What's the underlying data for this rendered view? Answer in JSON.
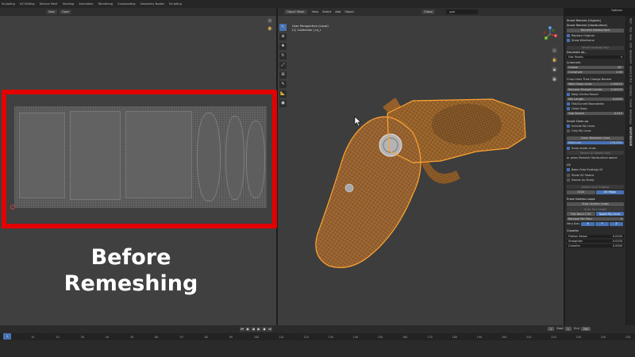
{
  "workspaces": [
    "Sculpting",
    "UV Editing",
    "Texture Paint",
    "Shading",
    "Animation",
    "Rendering",
    "Compositing",
    "Geometry Nodes",
    "Scripting"
  ],
  "uv_editor": {
    "new_label": "New",
    "open_label": "Open"
  },
  "caption": {
    "line1": "Before",
    "line2": "Remeshing"
  },
  "viewport": {
    "mode": "Object Mode",
    "menus": [
      "View",
      "Select",
      "Add",
      "Object"
    ],
    "orientation": "Global",
    "search_value": "gun",
    "view_title": "User Perspective (Local)",
    "collection": "(1) Collection | rp_r",
    "options_label": "Options",
    "gizmo": {
      "x": "X",
      "y": "Y",
      "z": "Z"
    }
  },
  "side_panel": {
    "rows": [
      {
        "kind": "header",
        "text": "Smart Remesh (Organic)"
      },
      {
        "kind": "header",
        "text": "Smart Remesh (Hardsurface)"
      },
      {
        "kind": "button",
        "text": "Remesh Hardsurface"
      },
      {
        "kind": "check",
        "text": "Replace Original",
        "on": true
      },
      {
        "kind": "check",
        "text": "Show Wireframe",
        "on": true
      },
      {
        "kind": "sep"
      },
      {
        "kind": "dimbutton",
        "text": "Smart Unwrap Only"
      },
      {
        "kind": "header",
        "text": "Decimate ab..."
      },
      {
        "kind": "select",
        "text": "Flat Panels"
      },
      {
        "kind": "label",
        "text": "Automatic"
      },
      {
        "kind": "field",
        "text": "Crease",
        "value": "30°"
      },
      {
        "kind": "field",
        "text": "Curvature",
        "value": "2.00"
      },
      {
        "kind": "sep"
      },
      {
        "kind": "label",
        "text": "Crisp Lines That Change Normal"
      },
      {
        "kind": "field",
        "text": "Weld Close Lines",
        "value": "0.00020"
      },
      {
        "kind": "field",
        "text": "Remove Straight Curves",
        "value": "0.00100"
      },
      {
        "kind": "check",
        "text": "Keep Circles Round",
        "on": true
      },
      {
        "kind": "field",
        "text": "Min Length",
        "value": "0.0000"
      },
      {
        "kind": "check",
        "text": "Flat/Curved Boundaries",
        "on": true
      },
      {
        "kind": "check",
        "text": "Close Gaps",
        "on": true
      },
      {
        "kind": "field",
        "text": "Gap Search",
        "value": "0.010"
      },
      {
        "kind": "sep"
      },
      {
        "kind": "header",
        "text": "Smart Clean-up"
      },
      {
        "kind": "check",
        "text": "Include My Lines",
        "on": true
      },
      {
        "kind": "check",
        "text": "Only My Lines",
        "on": false
      },
      {
        "kind": "sep"
      },
      {
        "kind": "button",
        "text": "Clean Between Lines"
      },
      {
        "kind": "bluefield",
        "text": "Minimum",
        "value": "176.00%"
      },
      {
        "kind": "check",
        "text": "Snap Inside Lines",
        "on": true
      },
      {
        "kind": "dimbutton",
        "text": "Smart UV Seams Only"
      },
      {
        "kind": "label",
        "text": "or press Remesh Hardsurface above"
      },
      {
        "kind": "sep"
      },
      {
        "kind": "header",
        "text": "UV"
      },
      {
        "kind": "check",
        "text": "Bake Onto Existing UV",
        "on": true
      },
      {
        "kind": "check",
        "text": "Show UV Seams",
        "on": false
      },
      {
        "kind": "check",
        "text": "Seams As Sharp",
        "on": false
      },
      {
        "kind": "sep"
      },
      {
        "kind": "dimbutton",
        "text": "Select Only Original"
      },
      {
        "kind": "pair",
        "text": "2024",
        "value": "UV Maps"
      },
      {
        "kind": "sep"
      },
      {
        "kind": "header",
        "text": "Erase Useless Loops"
      },
      {
        "kind": "button",
        "text": "Stop Useless Loops"
      },
      {
        "kind": "dimbutton",
        "text": "Auto Turn Loops"
      },
      {
        "kind": "pair",
        "text": "Flat Bend 2.50",
        "value": "Spare My Lines"
      },
      {
        "kind": "field",
        "text": "Remove Per Pass",
        "value": "4"
      },
      {
        "kind": "axes",
        "text": "Very Axis",
        "values": [
          "X",
          "Y",
          "Z"
        ]
      },
      {
        "kind": "sep"
      },
      {
        "kind": "header",
        "text": "Chamfer"
      },
      {
        "kind": "darkfield",
        "text": "Flatten Below",
        "value": "0.0100"
      },
      {
        "kind": "darkfield",
        "text": "Straighten",
        "value": "0.0100"
      },
      {
        "kind": "darkfield",
        "text": "Chamfer",
        "value": "0.0000"
      }
    ]
  },
  "side_tabs": [
    "Item",
    "Tool",
    "View",
    "Edit",
    "BlenderKit",
    "Shortcut VUr",
    "HardOps",
    "Fluent",
    "Retopology",
    "Smart Remesh"
  ],
  "timeline": {
    "frame_current": "1",
    "start_label": "Start",
    "start_value": "1",
    "end_label": "End",
    "end_value": "250",
    "ticks": [
      "0",
      "10",
      "20",
      "30",
      "40",
      "50",
      "60",
      "70",
      "80",
      "90",
      "100",
      "110",
      "120",
      "130",
      "140",
      "150",
      "160",
      "170",
      "180",
      "190",
      "200",
      "210",
      "220",
      "230",
      "240",
      "250"
    ]
  },
  "colors": {
    "highlight_frame": "#e30000",
    "accent": "#4772b3",
    "wire": "#e8952a"
  }
}
